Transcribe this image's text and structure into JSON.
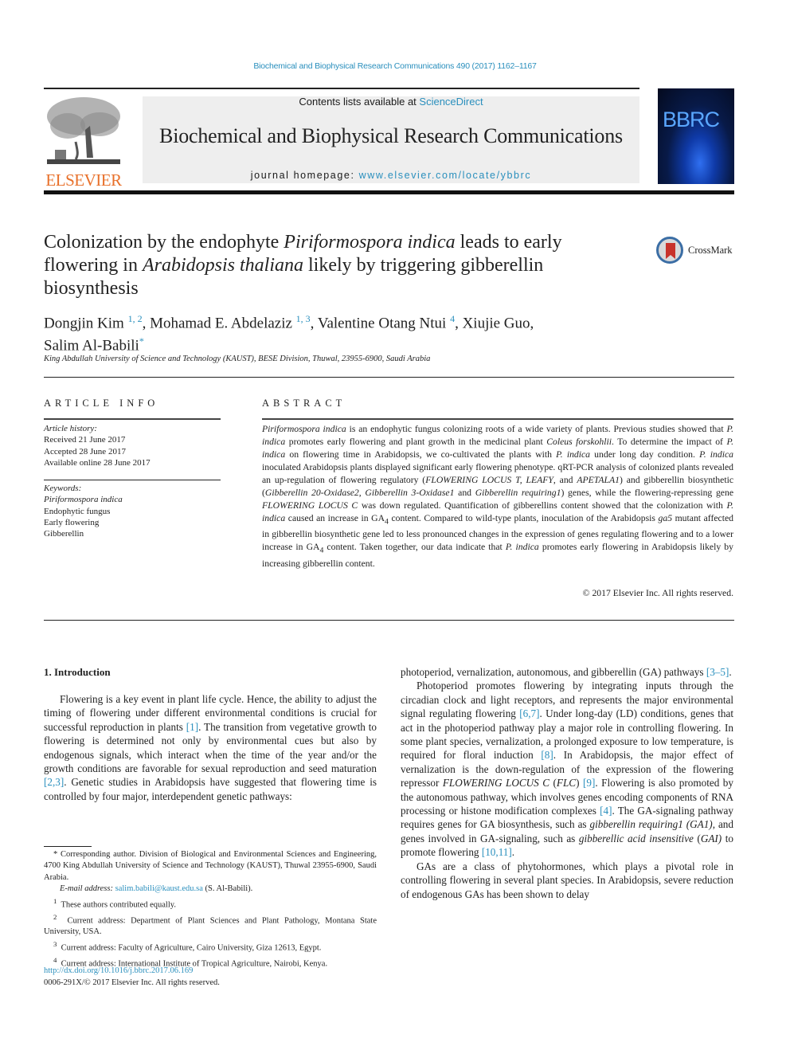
{
  "header": {
    "citation": "Biochemical and Biophysical Research Communications 490 (2017) 1162–1167",
    "contents_prefix": "Contents lists available at ",
    "contents_link": "ScienceDirect",
    "journal_title": "Biochemical and Biophysical Research Communications",
    "homepage_prefix": "journal homepage: ",
    "homepage_link": "www.elsevier.com/locate/ybbrc",
    "publisher_logo": "ELSEVIER",
    "cover_label": "BBRC",
    "crossmark_label": "CrossMark"
  },
  "article": {
    "title_parts": [
      "Colonization by the endophyte ",
      "Piriformospora indica",
      " leads to early flowering in ",
      "Arabidopsis thaliana",
      " likely by triggering gibberellin biosynthesis"
    ],
    "authors": [
      {
        "name": "Dongjin Kim",
        "sup": "1, 2"
      },
      {
        "name": "Mohamad E. Abdelaziz",
        "sup": "1, 3"
      },
      {
        "name": "Valentine Otang Ntui",
        "sup": "4"
      },
      {
        "name": "Xiujie Guo",
        "sup": ""
      },
      {
        "name": "Salim Al-Babili",
        "sup": "*"
      }
    ],
    "affiliation": "King Abdullah University of Science and Technology (KAUST), BESE Division, Thuwal, 23955-6900, Saudi Arabia"
  },
  "article_info": {
    "heading": "ARTICLE INFO",
    "history_label": "Article history:",
    "history": [
      "Received 21 June 2017",
      "Accepted 28 June 2017",
      "Available online 28 June 2017"
    ],
    "keywords_label": "Keywords:",
    "keywords": [
      "Piriformospora indica",
      "Endophytic fungus",
      "Early flowering",
      "Gibberellin"
    ]
  },
  "abstract": {
    "heading": "ABSTRACT",
    "copyright": "© 2017 Elsevier Inc. All rights reserved."
  },
  "introduction": {
    "heading": "1.  Introduction",
    "refs": [
      "[1]",
      "[2,3]",
      "[3–5]",
      "[6,7]",
      "[8]",
      "[9]",
      "[4]",
      "[10,11]"
    ]
  },
  "footnotes": {
    "corresponding": "* Corresponding author. Division of Biological and Environmental Sciences and Engineering, 4700 King Abdullah University of Science and Technology (KAUST), Thuwal 23955-6900, Saudi Arabia.",
    "email_label": "E-mail address: ",
    "email": "salim.babili@kaust.edu.sa",
    "email_suffix": " (S. Al-Babili).",
    "notes": [
      {
        "mark": "1",
        "text": "These authors contributed equally."
      },
      {
        "mark": "2",
        "text": "Current address: Department of Plant Sciences and Plant Pathology, Montana State University, USA."
      },
      {
        "mark": "3",
        "text": "Current address: Faculty of Agriculture, Cairo University, Giza 12613, Egypt."
      },
      {
        "mark": "4",
        "text": "Current address: International Institute of Tropical Agriculture, Nairobi, Kenya."
      }
    ],
    "doi": "http://dx.doi.org/10.1016/j.bbrc.2017.06.169",
    "issn": "0006-291X/© 2017 Elsevier Inc. All rights reserved."
  },
  "colors": {
    "link": "#2a8fbd",
    "elsevier_orange": "#e8702a",
    "masthead_gray": "#eeeeee"
  }
}
